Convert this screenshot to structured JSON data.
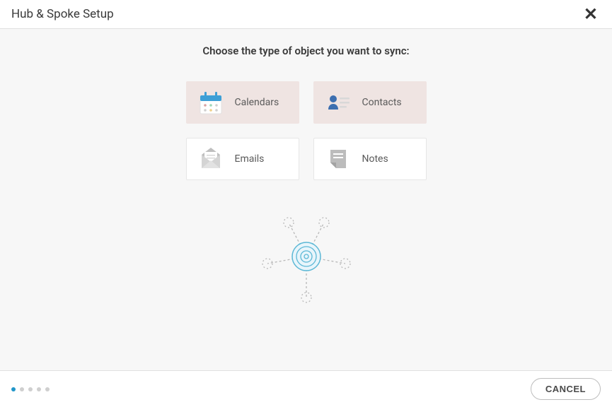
{
  "header": {
    "title": "Hub & Spoke Setup"
  },
  "main": {
    "instruction": "Choose the type of object you want to sync:",
    "cards": {
      "calendars": {
        "label": "Calendars",
        "selected": true
      },
      "contacts": {
        "label": "Contacts",
        "selected": true
      },
      "emails": {
        "label": "Emails",
        "selected": false
      },
      "notes": {
        "label": "Notes",
        "selected": false
      }
    }
  },
  "footer": {
    "cancel_label": "CANCEL",
    "progress": {
      "total_steps": 5,
      "current_step": 1
    }
  }
}
